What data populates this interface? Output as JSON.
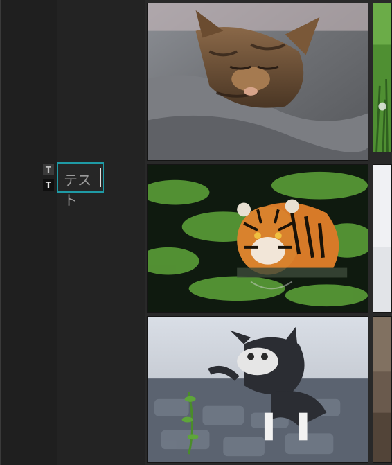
{
  "editor": {
    "text_tool_top_label": "T",
    "text_tool_bottom_label": "T",
    "text_input_value": "テスト"
  },
  "gallery": {
    "images": [
      {
        "name": "cat-sleeping-on-pillow"
      },
      {
        "name": "tiger-swimming"
      },
      {
        "name": "kitten-playing-with-plant"
      }
    ]
  },
  "colors": {
    "focus_border": "#1f9aa5",
    "panel_dark": "#1f1f1f",
    "panel_mid": "#232323"
  }
}
